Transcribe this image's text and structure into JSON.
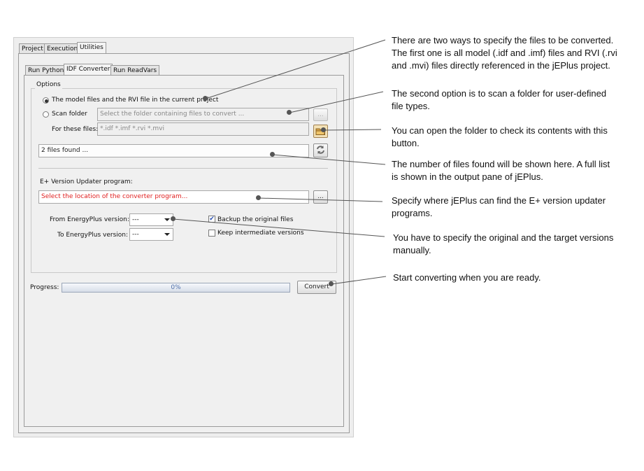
{
  "main_tabs": [
    "Project",
    "Execution",
    "Utilities"
  ],
  "sub_tabs": [
    "Run Python",
    "IDF Converter",
    "Run ReadVars"
  ],
  "options": {
    "group_label": "Options",
    "radio_project_label": "The model files and the RVI file in the current project",
    "radio_scan_label": "Scan folder",
    "folder_placeholder": "Select the folder containing files to convert ...",
    "browse_label": "...",
    "for_files_label": "For these files:",
    "file_types_value": "*.idf *.imf *.rvi *.mvi",
    "files_found": "2 files found ..."
  },
  "updater": {
    "label": "E+ Version Updater program:",
    "path_placeholder": "Select the location of the converter program...",
    "browse_label": "...",
    "from_label": "From EnergyPlus version:",
    "from_value": "---",
    "to_label": "To EnergyPlus version:",
    "to_value": "---",
    "backup_label": "Backup the original files",
    "backup_checked": true,
    "keep_label": "Keep intermediate versions",
    "keep_checked": false
  },
  "progress": {
    "label": "Progress:",
    "value_text": "0%",
    "value": 0
  },
  "convert_label": "Convert",
  "annotations": {
    "a1": [
      "There are two ways to specify the files to be converted.",
      "The first one is all model (.idf and .imf) files and RVI (.rvi",
      "and .mvi) files directly referenced in the jEPlus project."
    ],
    "a2": [
      "The second option is to scan a folder for user-defined",
      "file types."
    ],
    "a3": [
      "You can open the folder to check its contents with this",
      "button."
    ],
    "a4": [
      "The number of files found will be shown here. A full list",
      "is shown in the output pane of jEPlus."
    ],
    "a5": [
      "Specify where jEPlus can find the E+ version updater",
      "programs."
    ],
    "a6": [
      "You have to specify the original and the target versions",
      "manually."
    ],
    "a7": [
      "Start converting when you are ready."
    ]
  },
  "colors": {
    "callout_line": "#555555",
    "error_text": "#e02020",
    "progress_text": "#4e6ea8"
  }
}
